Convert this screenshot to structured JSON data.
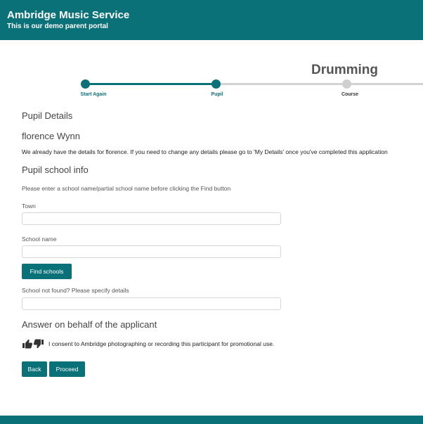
{
  "header": {
    "title": "Ambridge Music Service",
    "subtitle": "This is our demo parent portal"
  },
  "course_title": "Drumming",
  "steps": [
    {
      "label": "Start Again",
      "state": "done"
    },
    {
      "label": "Pupil",
      "state": "current"
    },
    {
      "label": "Course",
      "state": "todo"
    }
  ],
  "pupil": {
    "section_title": "Pupil Details",
    "name": "florence Wynn",
    "info": "We already have the details for florence. If you need to change any details please go to 'My Details' once you've completed this application"
  },
  "school": {
    "section_title": "Pupil school info",
    "instructions": "Please enter a school name/partial school name before clicking the Find button",
    "town_label": "Town",
    "town_value": "",
    "school_name_label": "School name",
    "school_name_value": "",
    "find_button": "Find schools",
    "not_found_label": "School not found? Please specify details",
    "not_found_value": ""
  },
  "consent": {
    "section_title": "Answer on behalf of the applicant",
    "icon": "thumbs-up-down-icon",
    "text": "I consent to Ambridge photographing or recording this participant for promotional use."
  },
  "actions": {
    "back": "Back",
    "proceed": "Proceed"
  },
  "colors": {
    "brand": "#0a7179",
    "progress_inactive": "#d3d3d3"
  }
}
